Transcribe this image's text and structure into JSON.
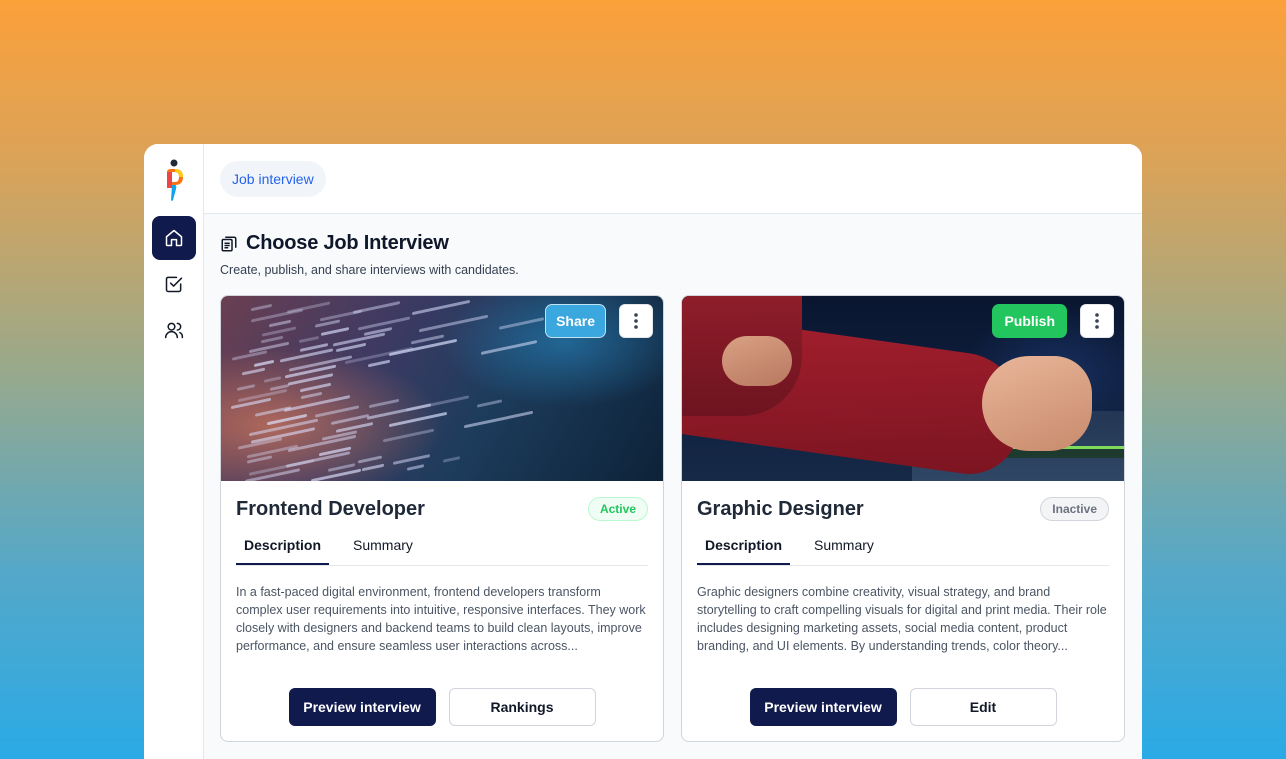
{
  "breadcrumb": {
    "label": "Job interview"
  },
  "page": {
    "title": "Choose Job Interview",
    "subtitle": "Create, publish, and share interviews with candidates."
  },
  "sidebar": {
    "items": [
      {
        "name": "home",
        "icon": "home-icon",
        "active": true
      },
      {
        "name": "tasks",
        "icon": "checkbox-icon",
        "active": false
      },
      {
        "name": "users",
        "icon": "users-icon",
        "active": false
      }
    ]
  },
  "colors": {
    "accent": "#101a4d",
    "share": "#3aa7df",
    "publish": "#22c55e"
  },
  "cards": [
    {
      "title": "Frontend Developer",
      "status": "Active",
      "top_action": "Share",
      "tabs": [
        "Description",
        "Summary"
      ],
      "description": "In a fast-paced digital environment, frontend developers transform complex user requirements into intuitive, responsive interfaces. They work closely with designers and backend teams to build clean layouts, improve performance, and ensure seamless user interactions across...",
      "primary_action": "Preview interview",
      "secondary_action": "Rankings"
    },
    {
      "title": "Graphic Designer",
      "status": "Inactive",
      "top_action": "Publish",
      "tabs": [
        "Description",
        "Summary"
      ],
      "description": "Graphic designers combine creativity, visual strategy, and brand storytelling to craft compelling visuals for digital and print media. Their role includes designing marketing assets, social media content, product branding, and UI elements. By understanding trends, color theory...",
      "primary_action": "Preview interview",
      "secondary_action": "Edit"
    }
  ]
}
